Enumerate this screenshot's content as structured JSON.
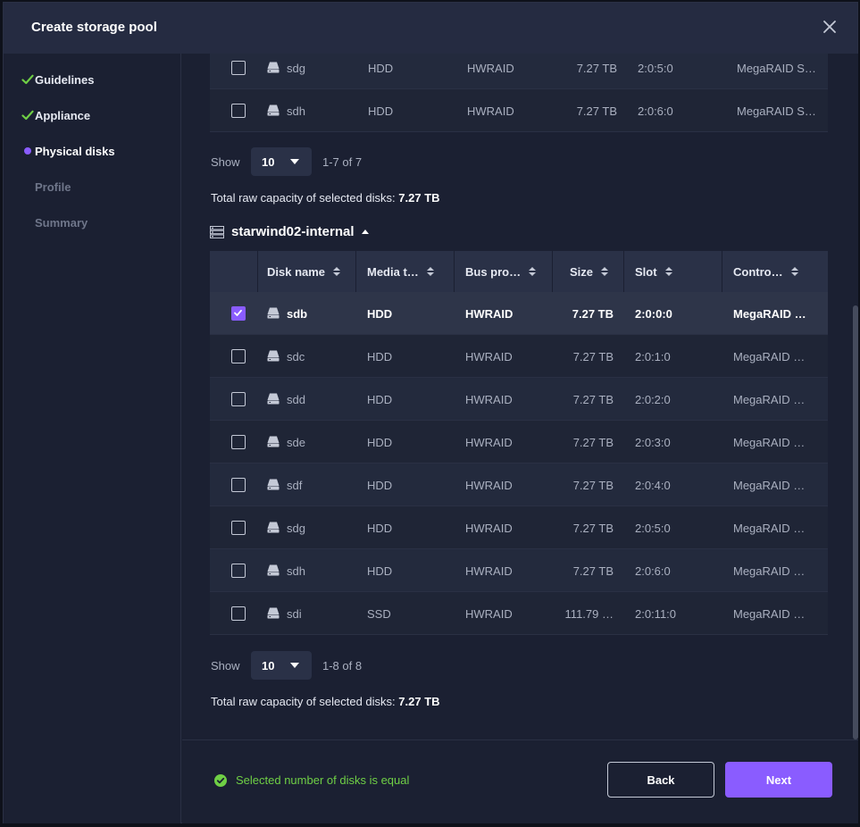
{
  "dialog": {
    "title": "Create storage pool"
  },
  "steps": [
    {
      "label": "Guidelines",
      "state": "done"
    },
    {
      "label": "Appliance",
      "state": "done"
    },
    {
      "label": "Physical disks",
      "state": "active"
    },
    {
      "label": "Profile",
      "state": "pending"
    },
    {
      "label": "Summary",
      "state": "pending"
    }
  ],
  "group1": {
    "rows": [
      {
        "name": "sdg",
        "media": "HDD",
        "bus": "HWRAID",
        "size": "7.27 TB",
        "slot": "2:0:5:0",
        "controller": "MegaRAID S…",
        "checked": false
      },
      {
        "name": "sdh",
        "media": "HDD",
        "bus": "HWRAID",
        "size": "7.27 TB",
        "slot": "2:0:6:0",
        "controller": "MegaRAID S…",
        "checked": false
      }
    ],
    "show_label": "Show",
    "page_size": "10",
    "range": "1-7 of 7",
    "capacity_label": "Total raw capacity of selected disks:",
    "capacity_value": "7.27 TB"
  },
  "group2": {
    "name": "starwind02-internal",
    "columns": [
      "Disk name",
      "Media t…",
      "Bus pro…",
      "Size",
      "Slot",
      "Contro…"
    ],
    "rows": [
      {
        "name": "sdb",
        "media": "HDD",
        "bus": "HWRAID",
        "size": "7.27 TB",
        "slot": "2:0:0:0",
        "controller": "MegaRAID …",
        "checked": true
      },
      {
        "name": "sdc",
        "media": "HDD",
        "bus": "HWRAID",
        "size": "7.27 TB",
        "slot": "2:0:1:0",
        "controller": "MegaRAID …",
        "checked": false
      },
      {
        "name": "sdd",
        "media": "HDD",
        "bus": "HWRAID",
        "size": "7.27 TB",
        "slot": "2:0:2:0",
        "controller": "MegaRAID …",
        "checked": false
      },
      {
        "name": "sde",
        "media": "HDD",
        "bus": "HWRAID",
        "size": "7.27 TB",
        "slot": "2:0:3:0",
        "controller": "MegaRAID …",
        "checked": false
      },
      {
        "name": "sdf",
        "media": "HDD",
        "bus": "HWRAID",
        "size": "7.27 TB",
        "slot": "2:0:4:0",
        "controller": "MegaRAID …",
        "checked": false
      },
      {
        "name": "sdg",
        "media": "HDD",
        "bus": "HWRAID",
        "size": "7.27 TB",
        "slot": "2:0:5:0",
        "controller": "MegaRAID …",
        "checked": false
      },
      {
        "name": "sdh",
        "media": "HDD",
        "bus": "HWRAID",
        "size": "7.27 TB",
        "slot": "2:0:6:0",
        "controller": "MegaRAID …",
        "checked": false
      },
      {
        "name": "sdi",
        "media": "SSD",
        "bus": "HWRAID",
        "size": "111.79 …",
        "slot": "2:0:11:0",
        "controller": "MegaRAID …",
        "checked": false
      }
    ],
    "show_label": "Show",
    "page_size": "10",
    "range": "1-8 of 8",
    "capacity_label": "Total raw capacity of selected disks:",
    "capacity_value": "7.27 TB"
  },
  "footer": {
    "status": "Selected number of disks is equal",
    "back_label": "Back",
    "next_label": "Next"
  },
  "colors": {
    "accent": "#8a5cff",
    "success": "#6fcf45",
    "done_check": "#6fcf45"
  },
  "icons": {
    "close": "close-icon",
    "check": "check-icon",
    "disk": "disk-icon",
    "server": "server-icon",
    "sort": "sort-icon",
    "caret": "chevron-down-icon"
  }
}
